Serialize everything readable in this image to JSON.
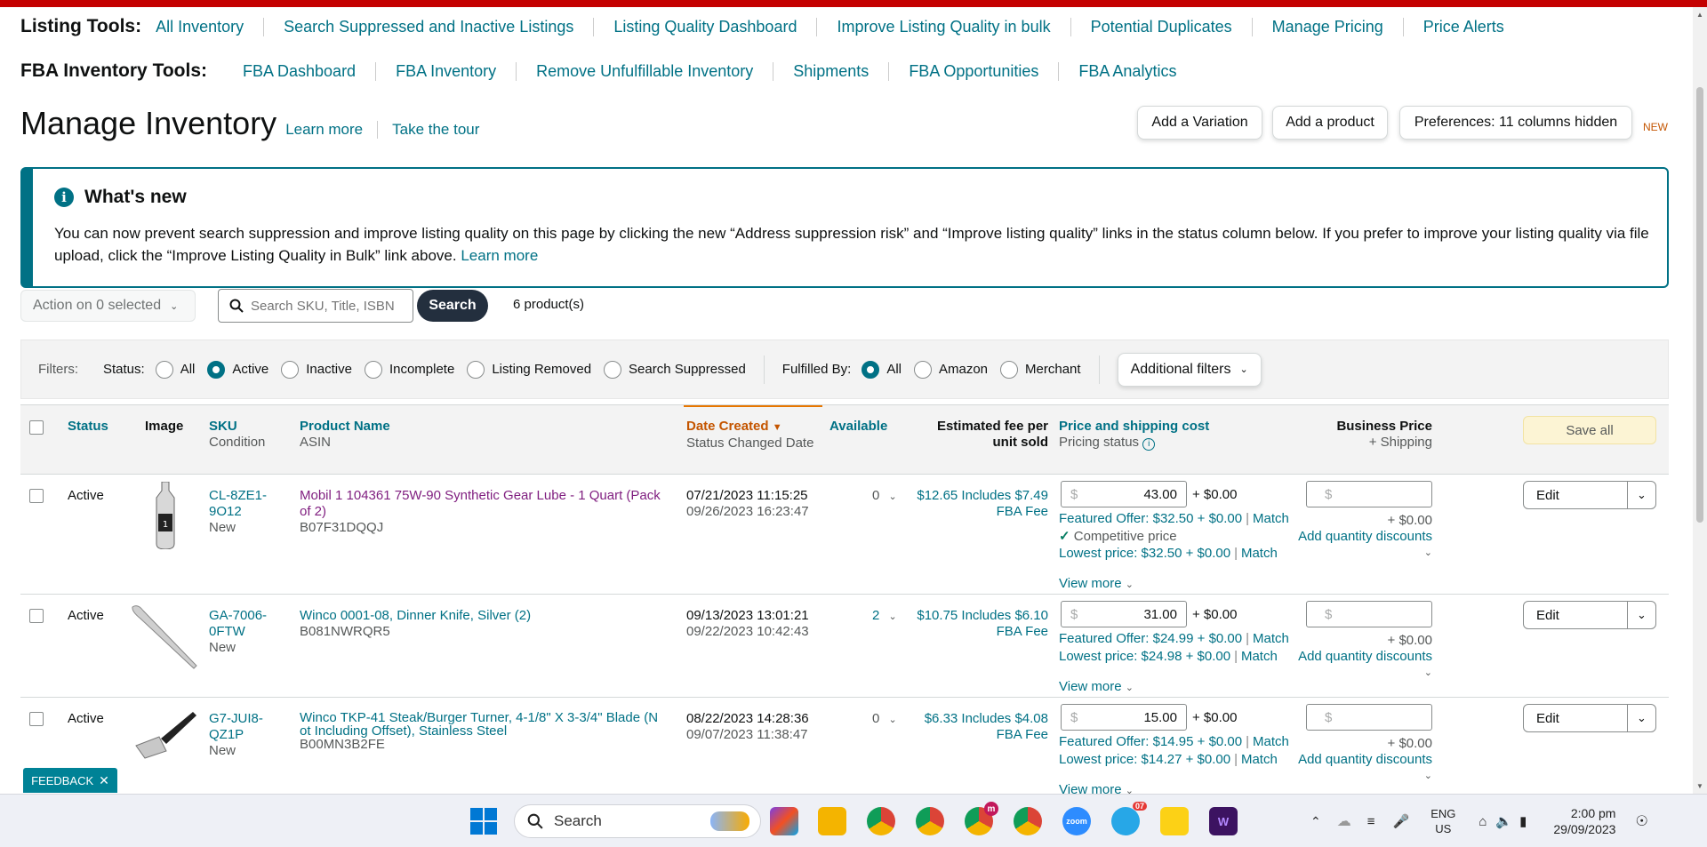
{
  "listing_tools": {
    "label": "Listing Tools:",
    "items": [
      "All Inventory",
      "Search Suppressed and Inactive Listings",
      "Listing Quality Dashboard",
      "Improve Listing Quality in bulk",
      "Potential Duplicates",
      "Manage Pricing",
      "Price Alerts"
    ]
  },
  "fba_tools": {
    "label": "FBA Inventory Tools:",
    "items": [
      "FBA Dashboard",
      "FBA Inventory",
      "Remove Unfulfillable Inventory",
      "Shipments",
      "FBA Opportunities",
      "FBA Analytics"
    ]
  },
  "header": {
    "title": "Manage Inventory",
    "learn_more": "Learn more",
    "tour": "Take the tour",
    "add_variation": "Add a Variation",
    "add_product": "Add a product",
    "preferences": "Preferences: 11 columns hidden",
    "new_tag": "NEW"
  },
  "whats_new": {
    "title": "What's new",
    "icon": "i",
    "body": "You can now prevent search suppression and improve listing quality on this page by clicking the new “Address suppression risk” and “Improve listing quality” links in the status column below. If you prefer to improve your listing quality via file upload, click the “Improve Listing Quality in Bulk” link above.",
    "learn_more": "Learn more"
  },
  "toolbar": {
    "action": "Action on 0 selected",
    "search_placeholder": "Search SKU, Title, ISBN",
    "search_button": "Search",
    "count": "6 product(s)"
  },
  "filters": {
    "label": "Filters:",
    "status_label": "Status:",
    "status_options": [
      "All",
      "Active",
      "Inactive",
      "Incomplete",
      "Listing Removed",
      "Search Suppressed"
    ],
    "status_selected": "Active",
    "fulfilled_label": "Fulfilled By:",
    "fulfilled_options": [
      "All",
      "Amazon",
      "Merchant"
    ],
    "fulfilled_selected": "All",
    "additional": "Additional filters"
  },
  "columns": {
    "status": "Status",
    "image": "Image",
    "sku": "SKU",
    "condition": "Condition",
    "product_name": "Product Name",
    "asin": "ASIN",
    "date_created": "Date Created",
    "status_changed": "Status Changed Date",
    "available": "Available",
    "fee_line1": "Estimated fee per",
    "fee_line2": "unit sold",
    "price": "Price and shipping cost",
    "pricing_status": "Pricing status",
    "business_price": "Business Price",
    "plus_shipping": "+ Shipping",
    "save_all": "Save all"
  },
  "rows": [
    {
      "status": "Active",
      "sku1": "CL-8ZE1-",
      "sku2": "9O12",
      "condition": "New",
      "name1": "Mobil 1 104361 75W-90 Synthetic Gear Lube - 1 Quart (Pack",
      "name2": "of 2)",
      "asin": "B07F31DQQJ",
      "created": "07/21/2023 11:15:25",
      "changed": "09/26/2023 16:23:47",
      "available": "0",
      "fee1": "$12.65 Includes $7.49",
      "fee2": "FBA Fee",
      "price": "43.00",
      "ship": "+ $0.00",
      "featured": "Featured Offer: $32.50 + $0.00",
      "competitive": "Competitive price",
      "lowest": "Lowest price: $32.50 + $0.00",
      "match": "Match",
      "view_more": "View more",
      "bp_ship": "+ $0.00",
      "qty_disc": "Add quantity discounts",
      "edit": "Edit",
      "currency": "$"
    },
    {
      "status": "Active",
      "sku1": "GA-7006-",
      "sku2": "0FTW",
      "condition": "New",
      "name1": "Winco 0001-08, Dinner Knife, Silver (2)",
      "name2": "",
      "asin": "B081NWRQR5",
      "created": "09/13/2023 13:01:21",
      "changed": "09/22/2023 10:42:43",
      "available": "2",
      "fee1": "$10.75 Includes $6.10",
      "fee2": "FBA Fee",
      "price": "31.00",
      "ship": "+ $0.00",
      "featured": "Featured Offer: $24.99 + $0.00",
      "lowest": "Lowest price: $24.98 + $0.00",
      "match": "Match",
      "view_more": "View more",
      "bp_ship": "+ $0.00",
      "qty_disc": "Add quantity discounts",
      "edit": "Edit",
      "currency": "$"
    },
    {
      "status": "Active",
      "sku1": "G7-JUI8-",
      "sku2": "QZ1P",
      "condition": "New",
      "name1": "Winco TKP-41 Steak/Burger Turner, 4-1/8\" X 3-3/4\" Blade (N",
      "name2": "ot Including Offset), Stainless Steel",
      "asin": "B00MN3B2FE",
      "created": "08/22/2023 14:28:36",
      "changed": "09/07/2023 11:38:47",
      "available": "0",
      "fee1": "$6.33 Includes $4.08",
      "fee2": "FBA Fee",
      "price": "15.00",
      "ship": "+ $0.00",
      "featured": "Featured Offer: $14.95 + $0.00",
      "lowest": "Lowest price: $14.27 + $0.00",
      "match": "Match",
      "view_more": "View more",
      "bp_ship": "+ $0.00",
      "qty_disc": "Add quantity discounts",
      "edit": "Edit",
      "currency": "$"
    }
  ],
  "feedback": "FEEDBACK",
  "taskbar": {
    "search": "Search",
    "lang1": "ENG",
    "lang2": "US",
    "time": "2:00 pm",
    "date": "29/09/2023",
    "badge_chrome": "m",
    "badge_telegram": "07"
  },
  "colors": {
    "link": "#007185",
    "brand_red": "#c40000",
    "visited": "#7f1d7f",
    "orange": "#c45500"
  }
}
